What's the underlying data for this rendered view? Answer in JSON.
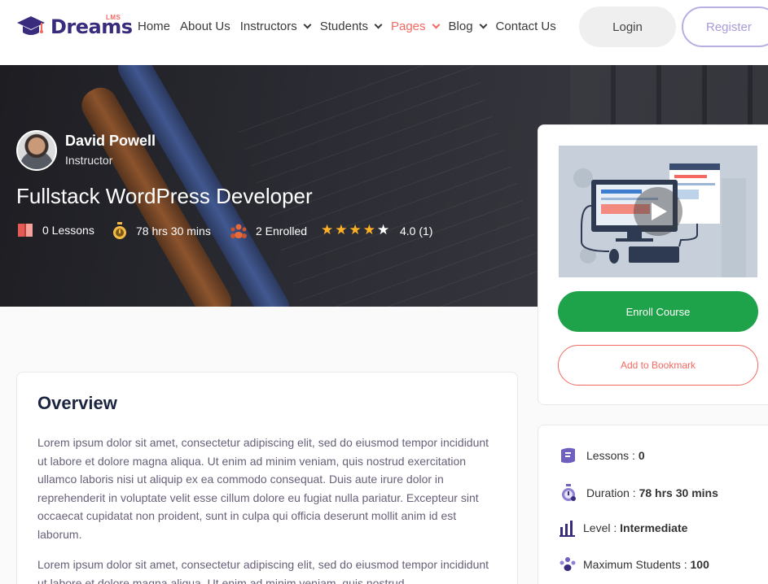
{
  "brand": {
    "name": "Dreams",
    "sup": "LMS"
  },
  "nav": {
    "items": [
      {
        "label": "Home"
      },
      {
        "label": "About Us"
      },
      {
        "label": "Instructors"
      },
      {
        "label": "Students"
      },
      {
        "label": "Pages"
      },
      {
        "label": "Blog"
      },
      {
        "label": "Contact Us"
      }
    ],
    "login_label": "Login",
    "register_label": "Register"
  },
  "course": {
    "instructor_name": "David Powell",
    "instructor_role": "Instructor",
    "title": "Fullstack WordPress Developer",
    "lessons": "0 Lessons",
    "duration": "78 hrs 30 mins",
    "enrolled": "2 Enrolled",
    "rating": "4.0 (1)"
  },
  "overview": {
    "title": "Overview",
    "paragraphs": [
      "Lorem ipsum dolor sit amet, consectetur adipiscing elit, sed do eiusmod tempor incididunt ut labore et dolore magna aliqua. Ut enim ad minim veniam, quis nostrud exercitation ullamco laboris nisi ut aliquip ex ea commodo consequat. Duis aute irure dolor in reprehenderit in voluptate velit esse cillum dolore eu fugiat nulla pariatur. Excepteur sint occaecat cupidatat non proident, sunt in culpa qui officia deserunt mollit anim id est laborum.",
      "Lorem ipsum dolor sit amet, consectetur adipiscing elit, sed do eiusmod tempor incididunt ut labore et dolore magna aliqua. Ut enim ad minim veniam, quis nostrud"
    ]
  },
  "sidebar": {
    "enroll_label": "Enroll Course",
    "bookmark_label": "Add to Bookmark",
    "stats": [
      {
        "label": "Lessons :",
        "value": "0"
      },
      {
        "label": "Duration :",
        "value": "78 hrs 30 mins"
      },
      {
        "label": "Level :",
        "value": "Intermediate"
      },
      {
        "label": "Maximum Students :",
        "value": "100"
      }
    ]
  },
  "colors": {
    "brand": "#392c7d",
    "accent": "#f66962",
    "enroll": "#1fa34a",
    "star": "#ffb125"
  }
}
